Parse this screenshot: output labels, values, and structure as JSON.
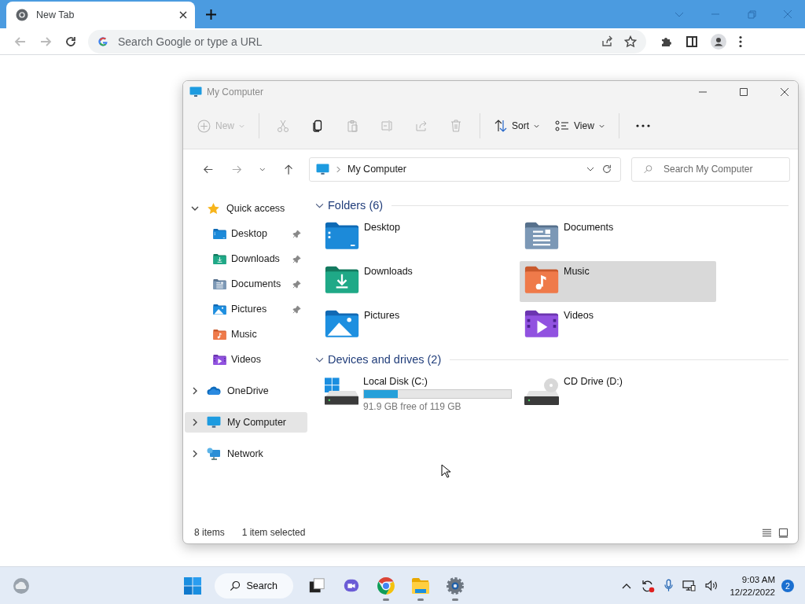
{
  "browser": {
    "tab": {
      "title": "New Tab"
    },
    "omnibox": {
      "placeholder": "Search Google or type a URL"
    }
  },
  "explorer": {
    "title": "My Computer",
    "commands": [
      {
        "kind": "new",
        "label": "New",
        "disabled": true
      },
      {
        "kind": "cut",
        "disabled": true
      },
      {
        "kind": "copy",
        "disabled": false
      },
      {
        "kind": "paste",
        "disabled": true
      },
      {
        "kind": "rename",
        "disabled": true
      },
      {
        "kind": "share",
        "disabled": true
      },
      {
        "kind": "delete",
        "disabled": true
      },
      {
        "kind": "sort",
        "label": "Sort",
        "disabled": false
      },
      {
        "kind": "view",
        "label": "View",
        "disabled": false
      },
      {
        "kind": "more"
      }
    ],
    "address": "My Computer",
    "search": {
      "placeholder": "Search My Computer"
    },
    "sidebar": [
      {
        "kind": "star",
        "label": "Quick access",
        "expanded": true,
        "selected": false,
        "children": [
          {
            "kind": "desktop",
            "label": "Desktop",
            "pinned": true,
            "selected": false
          },
          {
            "kind": "downloads",
            "label": "Downloads",
            "pinned": true,
            "selected": false
          },
          {
            "kind": "documents",
            "label": "Documents",
            "pinned": true,
            "selected": false
          },
          {
            "kind": "pictures",
            "label": "Pictures",
            "pinned": true,
            "selected": false
          },
          {
            "kind": "music",
            "label": "Music",
            "pinned": false,
            "selected": false
          },
          {
            "kind": "videos",
            "label": "Videos",
            "pinned": false,
            "selected": false
          }
        ]
      },
      {
        "kind": "cloud",
        "label": "OneDrive",
        "expanded": false,
        "selected": false
      },
      {
        "kind": "computer",
        "label": "My Computer",
        "expanded": false,
        "selected": true
      },
      {
        "kind": "network",
        "label": "Network",
        "expanded": false,
        "selected": false
      }
    ],
    "folders": {
      "heading": "Folders (6)",
      "items": [
        {
          "kind": "desktop",
          "label": "Desktop",
          "selected": false
        },
        {
          "kind": "documents",
          "label": "Documents",
          "selected": false
        },
        {
          "kind": "downloads",
          "label": "Downloads",
          "selected": false
        },
        {
          "kind": "music",
          "label": "Music",
          "selected": true
        },
        {
          "kind": "pictures",
          "label": "Pictures",
          "selected": false
        },
        {
          "kind": "videos",
          "label": "Videos",
          "selected": false
        }
      ]
    },
    "drives": {
      "heading": "Devices and drives (2)",
      "items": [
        {
          "kind": "disk",
          "label": "Local Disk (C:)",
          "level": 0.23,
          "free": "91.9 GB free of 119 GB"
        },
        {
          "kind": "cd",
          "label": "CD Drive (D:)"
        }
      ]
    },
    "status": {
      "count": "8 items",
      "selection": "1 item selected"
    }
  },
  "taskbar": {
    "search": "Search",
    "apps": [
      {
        "kind": "start",
        "running": false
      },
      {
        "kind": "search"
      },
      {
        "kind": "taskview",
        "running": false
      },
      {
        "kind": "chat",
        "running": false
      },
      {
        "kind": "chrome",
        "running": true
      },
      {
        "kind": "explorer",
        "running": true
      },
      {
        "kind": "settings",
        "running": true
      }
    ],
    "time": "9:03 AM",
    "date": "12/22/2022",
    "notifications": "2"
  }
}
